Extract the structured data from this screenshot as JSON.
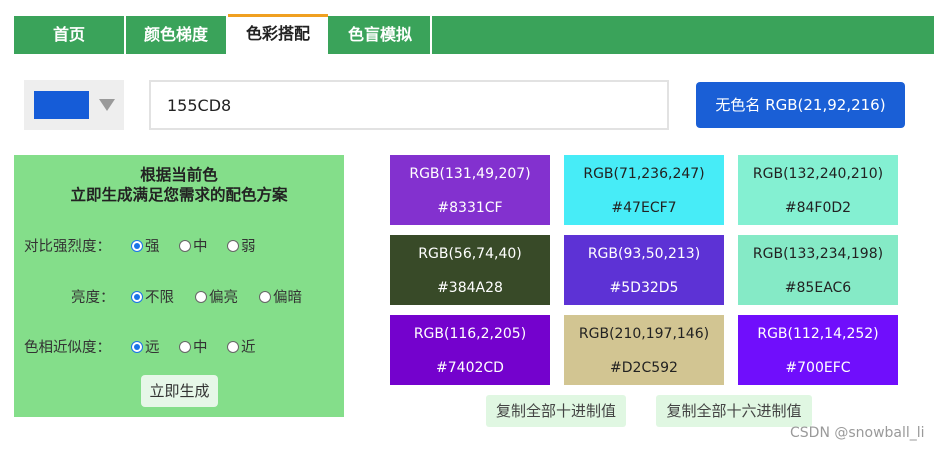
{
  "nav": {
    "tabs": [
      {
        "label": "首页"
      },
      {
        "label": "颜色梯度"
      },
      {
        "label": "色彩搭配"
      },
      {
        "label": "色盲模拟"
      }
    ]
  },
  "picker": {
    "swatch_color": "#155CD8",
    "hex_value": "155CD8",
    "name_button_label": "无色名 RGB(21,92,216)",
    "accent": "#1a5fd6"
  },
  "settings": {
    "title_line1": "根据当前色",
    "title_line2": "立即生成满足您需求的配色方案",
    "contrast": {
      "label": "对比强烈度：",
      "options": [
        "强",
        "中",
        "弱"
      ],
      "selected": "强"
    },
    "brightness": {
      "label": "亮度：",
      "options": [
        "不限",
        "偏亮",
        "偏暗"
      ],
      "selected": "不限"
    },
    "hue": {
      "label": "色相近似度：",
      "options": [
        "远",
        "中",
        "近"
      ],
      "selected": "远"
    },
    "generate_label": "立即生成"
  },
  "palette": [
    {
      "rgb": "RGB(131,49,207)",
      "hex": "#8331CF"
    },
    {
      "rgb": "RGB(71,236,247)",
      "hex": "#47ECF7"
    },
    {
      "rgb": "RGB(132,240,210)",
      "hex": "#84F0D2"
    },
    {
      "rgb": "RGB(56,74,40)",
      "hex": "#384A28"
    },
    {
      "rgb": "RGB(93,50,213)",
      "hex": "#5D32D5"
    },
    {
      "rgb": "RGB(133,234,198)",
      "hex": "#85EAC6"
    },
    {
      "rgb": "RGB(116,2,205)",
      "hex": "#7402CD"
    },
    {
      "rgb": "RGB(210,197,146)",
      "hex": "#D2C592"
    },
    {
      "rgb": "RGB(112,14,252)",
      "hex": "#700EFC"
    }
  ],
  "copy": {
    "decimal_label": "复制全部十进制值",
    "hex_label": "复制全部十六进制值"
  },
  "watermark": "CSDN @snowball_li"
}
